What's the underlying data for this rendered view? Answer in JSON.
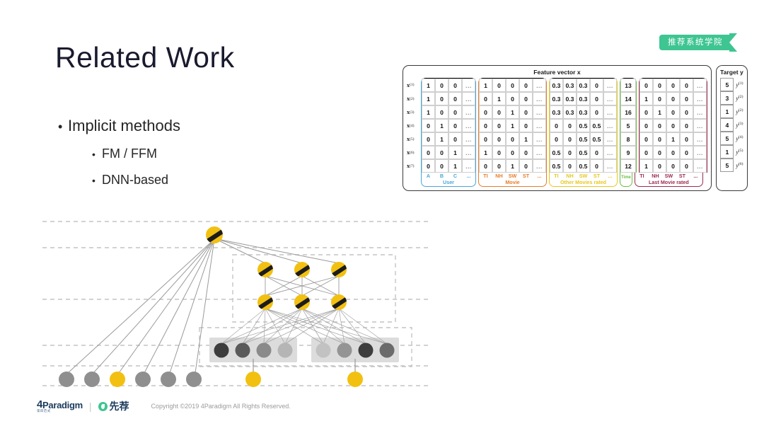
{
  "slide": {
    "title": "Related Work",
    "bullets": [
      {
        "level": 1,
        "text": "Implicit methods"
      },
      {
        "level": 2,
        "text": "FM / FFM"
      },
      {
        "level": 2,
        "text": "DNN-based"
      }
    ]
  },
  "ribbon": {
    "label": "推荐系统学院",
    "color": "#3ec592"
  },
  "footer": {
    "brand": "Paradigm",
    "brand_prefix": "4",
    "brand_sub": "第四范式",
    "separator": "|",
    "partner": "先荐",
    "copyright": "Copyright ©2019 4Paradigm All Rights Reserved."
  },
  "figure": {
    "caption_x": "Feature vector x",
    "caption_y": "Target y",
    "ellipsis": "...",
    "row_labels": [
      "x",
      "x",
      "x",
      "x",
      "x",
      "x",
      "x"
    ],
    "row_label_sups": [
      "(1)",
      "(2)",
      "(3)",
      "(4)",
      "(5)",
      "(6)",
      "(7)"
    ],
    "groups": [
      {
        "name": "User",
        "color": "#49a7d9",
        "class": "g-blue",
        "headers": [
          "A",
          "B",
          "C",
          "..."
        ],
        "rows": [
          [
            "1",
            "0",
            "0",
            "..."
          ],
          [
            "1",
            "0",
            "0",
            "..."
          ],
          [
            "1",
            "0",
            "0",
            "..."
          ],
          [
            "0",
            "1",
            "0",
            "..."
          ],
          [
            "0",
            "1",
            "0",
            "..."
          ],
          [
            "0",
            "0",
            "1",
            "..."
          ],
          [
            "0",
            "0",
            "1",
            "..."
          ]
        ]
      },
      {
        "name": "Movie",
        "color": "#e87d2a",
        "class": "g-orange",
        "headers": [
          "TI",
          "NH",
          "SW",
          "ST",
          "..."
        ],
        "rows": [
          [
            "1",
            "0",
            "0",
            "0",
            "..."
          ],
          [
            "0",
            "1",
            "0",
            "0",
            "..."
          ],
          [
            "0",
            "0",
            "1",
            "0",
            "..."
          ],
          [
            "0",
            "0",
            "1",
            "0",
            "..."
          ],
          [
            "0",
            "0",
            "0",
            "1",
            "..."
          ],
          [
            "1",
            "0",
            "0",
            "0",
            "..."
          ],
          [
            "0",
            "0",
            "1",
            "0",
            "..."
          ]
        ]
      },
      {
        "name": "Other Movies rated",
        "color": "#e8c820",
        "class": "g-yellow",
        "headers": [
          "TI",
          "NH",
          "SW",
          "ST",
          "..."
        ],
        "rows": [
          [
            "0.3",
            "0.3",
            "0.3",
            "0",
            "..."
          ],
          [
            "0.3",
            "0.3",
            "0.3",
            "0",
            "..."
          ],
          [
            "0.3",
            "0.3",
            "0.3",
            "0",
            "..."
          ],
          [
            "0",
            "0",
            "0.5",
            "0.5",
            "..."
          ],
          [
            "0",
            "0",
            "0.5",
            "0.5",
            "..."
          ],
          [
            "0.5",
            "0",
            "0.5",
            "0",
            "..."
          ],
          [
            "0.5",
            "0",
            "0.5",
            "0",
            "..."
          ]
        ]
      },
      {
        "name": "Time",
        "color": "#6cbe45",
        "class": "g-green",
        "headers": [
          "Time"
        ],
        "rows": [
          [
            "13"
          ],
          [
            "14"
          ],
          [
            "16"
          ],
          [
            "5"
          ],
          [
            "8"
          ],
          [
            "9"
          ],
          [
            "12"
          ]
        ]
      },
      {
        "name": "Last Movie rated",
        "color": "#9e2b4e",
        "class": "g-red",
        "headers": [
          "TI",
          "NH",
          "SW",
          "ST",
          "..."
        ],
        "rows": [
          [
            "0",
            "0",
            "0",
            "0",
            "..."
          ],
          [
            "1",
            "0",
            "0",
            "0",
            "..."
          ],
          [
            "0",
            "1",
            "0",
            "0",
            "..."
          ],
          [
            "0",
            "0",
            "0",
            "0",
            "..."
          ],
          [
            "0",
            "0",
            "1",
            "0",
            "..."
          ],
          [
            "0",
            "0",
            "0",
            "0",
            "..."
          ],
          [
            "1",
            "0",
            "0",
            "0",
            "..."
          ]
        ]
      }
    ],
    "target": {
      "values": [
        "5",
        "3",
        "1",
        "4",
        "5",
        "1",
        "5"
      ],
      "sups": [
        "(1)",
        "(2)",
        "(2)",
        "(3)",
        "(4)",
        "(5)",
        "(6)"
      ],
      "symbol": "y"
    }
  },
  "network": {
    "colors": {
      "node_yellow": "#f2c011",
      "node_gray": "#8f8f8f",
      "edge": "#9a9a9a",
      "dash": "#c4c4c4",
      "embed_band": "#dcdcdc",
      "stripe": "#1c1c1c"
    },
    "layers": {
      "output_nodes": 1,
      "hidden_rows": 2,
      "hidden_per_row": 3,
      "embedding_groups": 2,
      "embedding_per_group": 4,
      "input_left_nodes": 6,
      "input_field_nodes": 2
    },
    "input_left_fill": [
      "gray",
      "gray",
      "yellow",
      "gray",
      "gray",
      "gray"
    ],
    "embedding_shades": [
      "#3d3d3d",
      "#5a5a5a",
      "#8a8a8a",
      "#b5b5b5",
      "#c2c2c2",
      "#949494",
      "#3d3d3d",
      "#6b6b6b"
    ]
  }
}
